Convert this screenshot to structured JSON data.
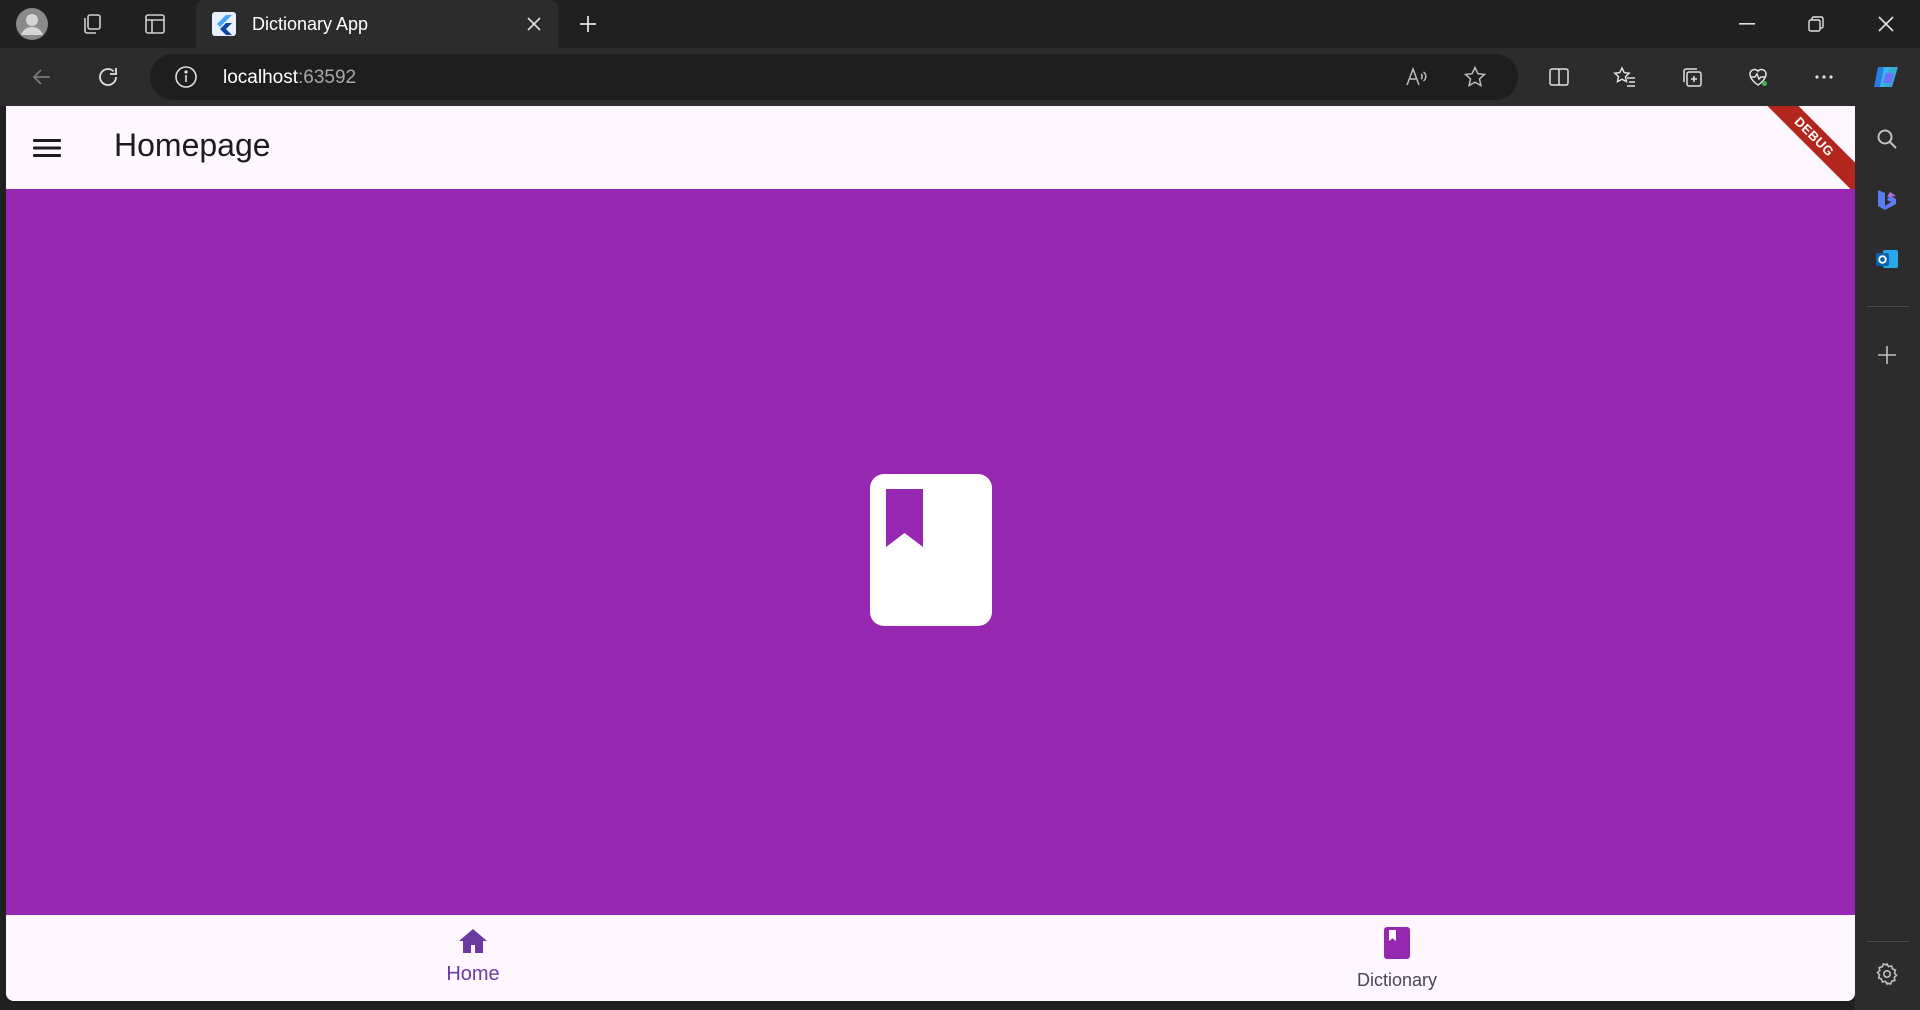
{
  "browser": {
    "tab": {
      "title": "Dictionary App"
    },
    "address": {
      "host": "localhost",
      "port": ":63592"
    }
  },
  "app": {
    "title": "Homepage",
    "debug_banner": "DEBUG",
    "colors": {
      "primary": "#9527b0",
      "surface": "#fef7ff",
      "nav_active": "#6b3aa0"
    },
    "content_icon": "book-bookmark-icon",
    "nav": [
      {
        "label": "Home",
        "icon": "home-icon",
        "active": true
      },
      {
        "label": "Dictionary",
        "icon": "book-icon",
        "active": false
      }
    ]
  }
}
